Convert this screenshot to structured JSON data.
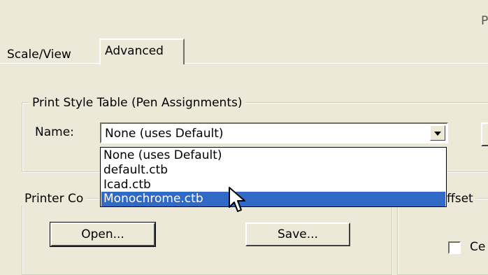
{
  "window_title_fragment": "P",
  "tabs": [
    {
      "label": "Scale/View"
    },
    {
      "label": "Advanced"
    }
  ],
  "print_style_group": {
    "legend": "Print Style Table (Pen Assignments)",
    "name_label": "Name:",
    "selected_value": "None (uses Default)",
    "options": [
      "None (uses Default)",
      "default.ctb",
      "Icad.ctb",
      "Monochrome.ctb"
    ],
    "highlighted_option": "Monochrome.ctb"
  },
  "printer_config_group": {
    "legend_visible": "Printer Co",
    "open_label": "Open...",
    "save_label": "Save..."
  },
  "offset_group": {
    "legend_visible": "ffset",
    "checkbox_label_visible": "Ce"
  },
  "colors": {
    "face": "#ece9d8",
    "highlight": "#316ac5"
  },
  "icons": [
    "dropdown-arrow-icon",
    "mouse-cursor-icon"
  ]
}
